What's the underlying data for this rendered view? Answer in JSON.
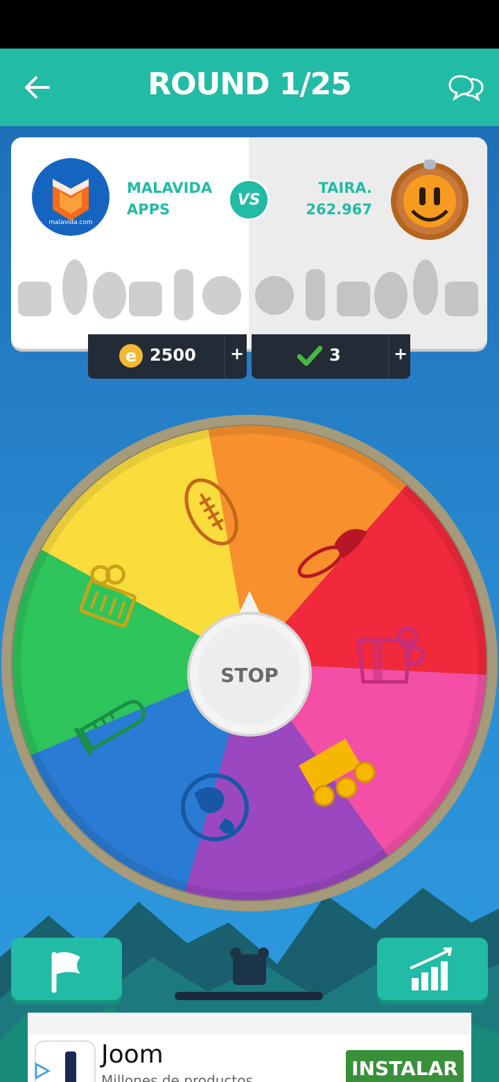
{
  "header": {
    "title": "ROUND 1/25",
    "back_icon": "arrow-left-icon",
    "chat_icon": "chat-bubbles-icon"
  },
  "players": {
    "left": {
      "name_line1": "MALAVIDA",
      "name_line2": "APPS",
      "avatar_brand": "malavida.com"
    },
    "vs_label": "VS",
    "right": {
      "name_line1": "TAIRA.",
      "name_line2": "262.967"
    }
  },
  "stats": {
    "coins": {
      "value": "2500",
      "plus": "+",
      "icon": "coin-icon"
    },
    "correct": {
      "value": "3",
      "plus": "+",
      "icon": "checkmark-icon"
    }
  },
  "wheel": {
    "center_label": "STOP",
    "segments": [
      {
        "category": "sports",
        "icon": "football-icon",
        "color": "#f7902d"
      },
      {
        "category": "art",
        "icon": "paintbrush-icon",
        "color": "#f0293c"
      },
      {
        "category": "entertainment",
        "icon": "popcorn-icon",
        "color": "#f34fa6"
      },
      {
        "category": "crown",
        "icon": "crown-icon",
        "color": "#9a47c0"
      },
      {
        "category": "geography",
        "icon": "globe-icon",
        "color": "#2a7bd3"
      },
      {
        "category": "science",
        "icon": "test-tube-icon",
        "color": "#2dc45c"
      },
      {
        "category": "history",
        "icon": "scroll-icon",
        "color": "#fadc3c"
      }
    ]
  },
  "bottom": {
    "flag_icon": "flag-icon",
    "stats_icon": "bar-chart-icon"
  },
  "ad": {
    "title": "Joom",
    "subtitle": "Millones de productos",
    "cta": "INSTALAR"
  },
  "colors": {
    "primary": "#22bba5",
    "dark": "#222b36"
  }
}
